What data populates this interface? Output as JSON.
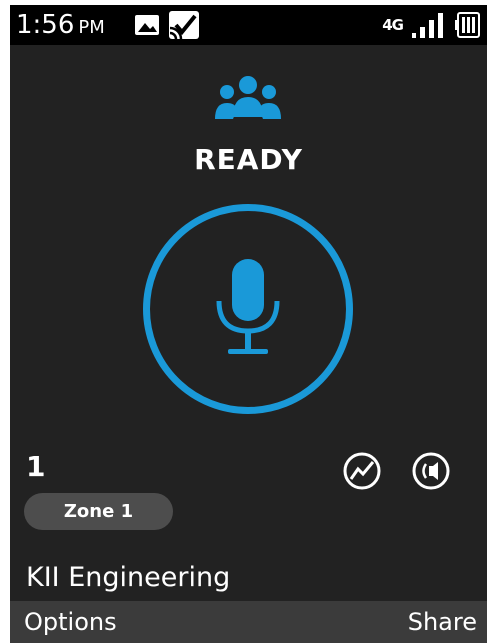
{
  "status_bar": {
    "time": "1:56",
    "ampm": "PM",
    "network_label": "4G",
    "left_icons": [
      "image-icon",
      "cast-check-icon"
    ],
    "right_icons": [
      "signal-icon",
      "battery-icon"
    ]
  },
  "ptt": {
    "status": "READY",
    "channel_number": "1",
    "zone_label": "Zone 1",
    "group_name": "KII Engineering",
    "accent_color": "#1a99d8"
  },
  "softkeys": {
    "left": "Options",
    "right": "Share"
  }
}
